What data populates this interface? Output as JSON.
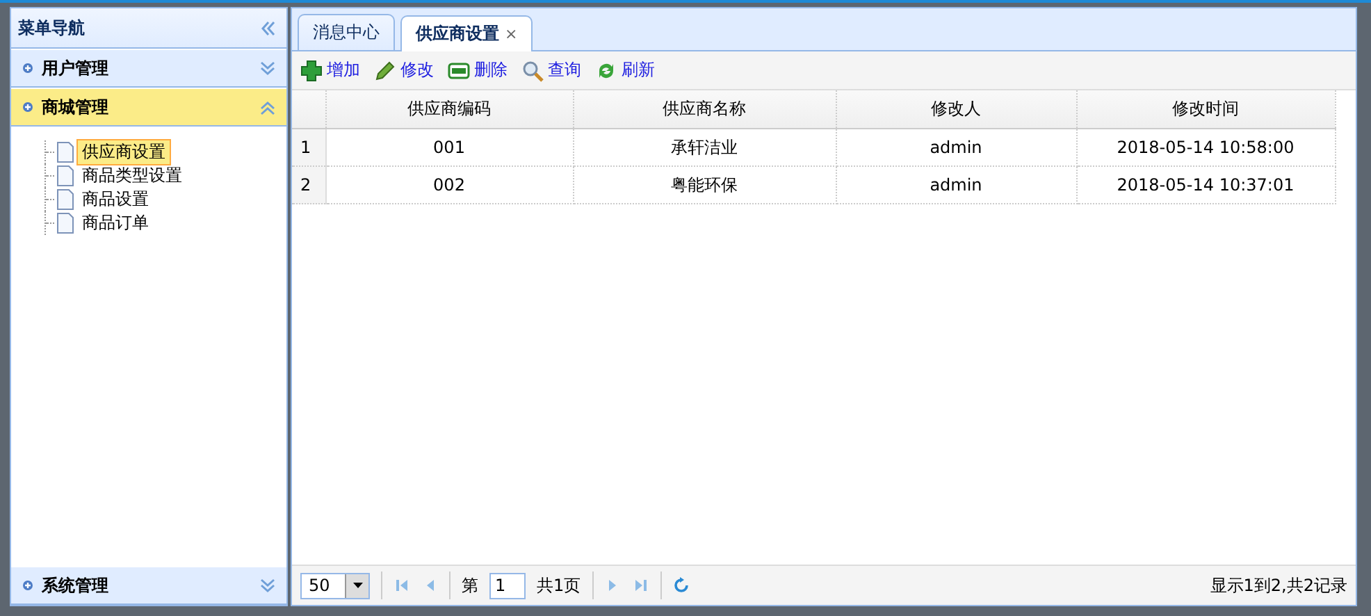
{
  "sidebar": {
    "title": "菜单导航",
    "sections": [
      {
        "title": "用户管理",
        "expanded": false
      },
      {
        "title": "商城管理",
        "expanded": true,
        "items": [
          {
            "label": "供应商设置",
            "selected": true
          },
          {
            "label": "商品类型设置",
            "selected": false
          },
          {
            "label": "商品设置",
            "selected": false
          },
          {
            "label": "商品订单",
            "selected": false
          }
        ]
      },
      {
        "title": "系统管理",
        "expanded": false
      }
    ]
  },
  "tabs": [
    {
      "label": "消息中心",
      "selected": false
    },
    {
      "label": "供应商设置",
      "selected": true,
      "close": "×"
    }
  ],
  "toolbar": [
    {
      "label": "增加",
      "kind": "add"
    },
    {
      "label": "修改",
      "kind": "edit"
    },
    {
      "label": "删除",
      "kind": "remove"
    },
    {
      "label": "查询",
      "kind": "search"
    },
    {
      "label": "刷新",
      "kind": "reload"
    }
  ],
  "table": {
    "columns": [
      "供应商编码",
      "供应商名称",
      "修改人",
      "修改时间"
    ],
    "rows": [
      {
        "number": "1",
        "cells": [
          "001",
          "承轩洁业",
          "admin",
          "2018-05-14 10:58:00"
        ]
      },
      {
        "number": "2",
        "cells": [
          "002",
          "粤能环保",
          "admin",
          "2018-05-14 10:37:01"
        ]
      }
    ]
  },
  "pager": {
    "page_size": "50",
    "page_label": "第",
    "page": "1",
    "total_pages": "共1页",
    "summary": "显示1到2,共2记录"
  }
}
